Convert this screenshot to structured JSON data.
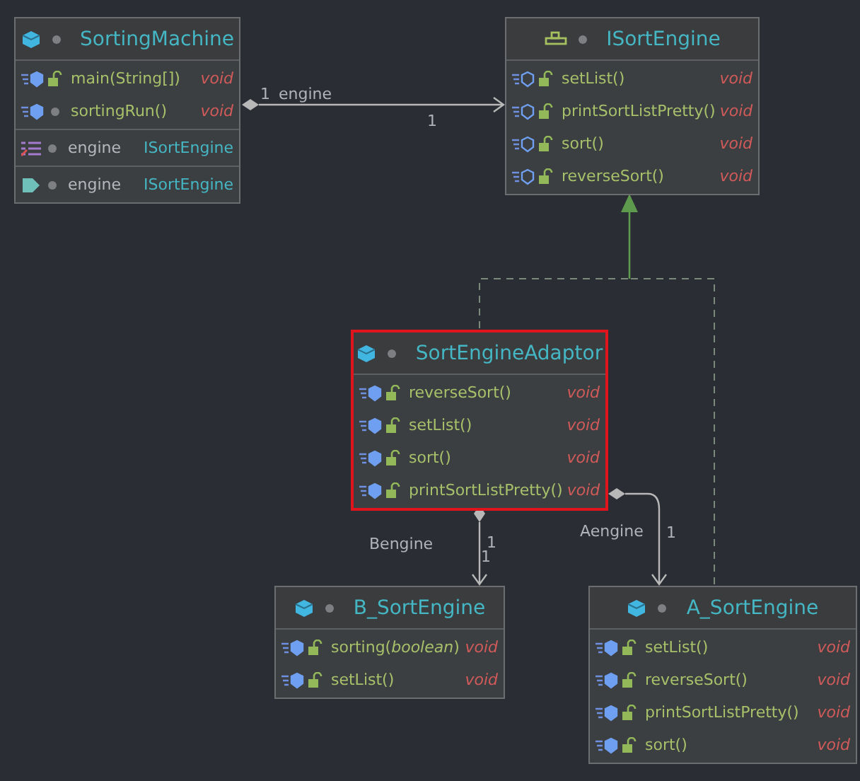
{
  "nodes": [
    {
      "name": "SortingMachine",
      "kind": "class",
      "selected": false,
      "sections": [
        {
          "kind": "methods",
          "members": [
            {
              "name": "main(String[])",
              "type": "void",
              "public": true
            },
            {
              "name": "sortingRun()",
              "type": "void",
              "public": false
            }
          ]
        },
        {
          "kind": "fields",
          "members": [
            {
              "name": "engine",
              "type": "ISortEngine",
              "public": false
            }
          ]
        },
        {
          "kind": "properties",
          "members": [
            {
              "name": "engine",
              "type": "ISortEngine",
              "public": false
            }
          ]
        }
      ]
    },
    {
      "name": "ISortEngine",
      "kind": "interface",
      "selected": false,
      "sections": [
        {
          "kind": "methods",
          "members": [
            {
              "name": "setList()",
              "type": "void",
              "public": true
            },
            {
              "name": "printSortListPretty()",
              "type": "void",
              "public": true
            },
            {
              "name": "sort()",
              "type": "void",
              "public": true
            },
            {
              "name": "reverseSort()",
              "type": "void",
              "public": true
            }
          ]
        }
      ]
    },
    {
      "name": "SortEngineAdaptor",
      "kind": "class",
      "selected": true,
      "sections": [
        {
          "kind": "methods",
          "members": [
            {
              "name": "reverseSort()",
              "type": "void",
              "public": true
            },
            {
              "name": "setList()",
              "type": "void",
              "public": true
            },
            {
              "name": "sort()",
              "type": "void",
              "public": true
            },
            {
              "name": "printSortListPretty()",
              "type": "void",
              "public": true
            }
          ]
        }
      ]
    },
    {
      "name": "B_SortEngine",
      "kind": "class",
      "selected": false,
      "sections": [
        {
          "kind": "methods",
          "members": [
            {
              "name": "sorting(*boolean*)",
              "type": "void",
              "public": true
            },
            {
              "name": "setList()",
              "type": "void",
              "public": true
            }
          ]
        }
      ]
    },
    {
      "name": "A_SortEngine",
      "kind": "class",
      "selected": false,
      "sections": [
        {
          "kind": "methods",
          "members": [
            {
              "name": "setList()",
              "type": "void",
              "public": true
            },
            {
              "name": "reverseSort()",
              "type": "void",
              "public": true
            },
            {
              "name": "printSortListPretty()",
              "type": "void",
              "public": true
            },
            {
              "name": "sort()",
              "type": "void",
              "public": true
            }
          ]
        }
      ]
    }
  ],
  "edges": [
    {
      "kind": "composition",
      "labels": [
        "engine",
        "1",
        "1"
      ]
    },
    {
      "kind": "realization"
    },
    {
      "kind": "composition",
      "labels": [
        "Bengine",
        "1",
        "1"
      ]
    },
    {
      "kind": "composition",
      "labels": [
        "Aengine",
        "1"
      ]
    }
  ]
}
